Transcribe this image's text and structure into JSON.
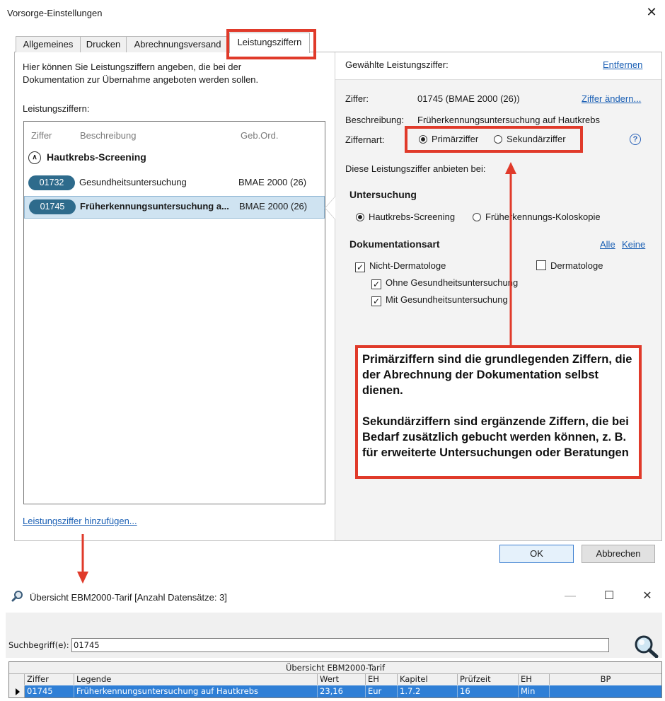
{
  "dialog": {
    "title": "Vorsorge-Einstellungen",
    "tabs": [
      "Allgemeines",
      "Drucken",
      "Abrechnungsversand",
      "Leistungsziffern"
    ],
    "active_tab": "Leistungsziffern",
    "left": {
      "intro": "Hier können Sie Leistungsziffern angeben, die bei der Dokumentation zur Übernahme angeboten werden sollen.",
      "list_label": "Leistungsziffern:",
      "columns": [
        "Ziffer",
        "Beschreibung",
        "Geb.Ord."
      ],
      "group": "Hautkrebs-Screening",
      "rows": [
        {
          "ziffer": "01732",
          "beschreibung": "Gesundheitsuntersuchung",
          "geb": "BMAE 2000 (26)"
        },
        {
          "ziffer": "01745",
          "beschreibung": "Früherkennungsuntersuchung a...",
          "geb": "BMAE 2000 (26)"
        }
      ],
      "add_link": "Leistungsziffer hinzufügen..."
    },
    "right": {
      "header": "Gewählte Leistungsziffer:",
      "remove_link": "Entfernen",
      "ziffer_label": "Ziffer:",
      "ziffer_value": "01745 (BMAE 2000 (26))",
      "change_link": "Ziffer ändern...",
      "beschreibung_label": "Beschreibung:",
      "beschreibung_value": "Früherkennungsuntersuchung auf Hautkrebs",
      "ziffernart_label": "Ziffernart:",
      "primaer": "Primärziffer",
      "sekundaer": "Sekundärziffer",
      "offer_label": "Diese Leistungsziffer anbieten bei:",
      "untersuchung_title": "Untersuchung",
      "untersuchung_options": [
        "Hautkrebs-Screening",
        "Früherkennungs-Koloskopie"
      ],
      "doku_title": "Dokumentationsart",
      "alle_link": "Alle",
      "keine_link": "Keine",
      "nicht_derm": "Nicht-Dermatologe",
      "derm": "Dermatologe",
      "ohne_gu": "Ohne Gesundheitsuntersuchung",
      "mit_gu": "Mit Gesundheitsuntersuchung"
    },
    "annotation": [
      "Primärziffern sind die grundlegenden Ziffern, die der Abrechnung der Dokumentation selbst dienen.",
      "Sekundärziffern sind ergänzende Ziffern, die bei Bedarf zusätzlich gebucht werden können, z. B. für erweiterte Untersuchungen oder Beratungen"
    ],
    "ok_label": "OK",
    "cancel_label": "Abbrechen",
    "accent_color": "#e03a2a"
  },
  "window2": {
    "title": "Übersicht EBM2000-Tarif [Anzahl Datensätze: 3]",
    "search_label": "Suchbegriff(e):",
    "search_value": "01745",
    "grid_caption": "Übersicht EBM2000-Tarif",
    "columns": [
      "Ziffer",
      "Legende",
      "Wert",
      "EH",
      "Kapitel",
      "Prüfzeit",
      "EH",
      "BP"
    ],
    "row": [
      "01745",
      "Früherkennungsuntersuchung auf Hautkrebs",
      "23,16",
      "Eur",
      "1.7.2",
      "16",
      "Min",
      ""
    ],
    "icons": [
      "magnifier-icon",
      "minimize-icon",
      "maximize-icon",
      "close-icon"
    ],
    "selection_color": "#2f7fd6"
  }
}
